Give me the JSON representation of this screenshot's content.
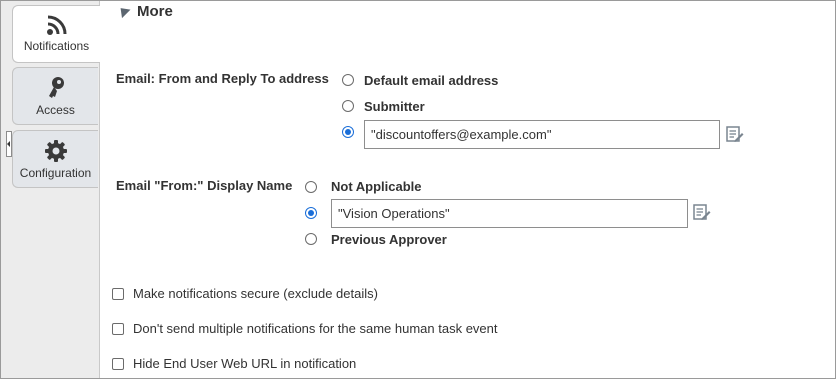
{
  "sidebar": {
    "tabs": [
      {
        "label": "Notifications",
        "icon": "rss-icon",
        "active": true
      },
      {
        "label": "Access",
        "icon": "key-icon",
        "active": false
      },
      {
        "label": "Configuration",
        "icon": "gear-icon",
        "active": false
      }
    ]
  },
  "section": {
    "title": "More"
  },
  "email_from": {
    "label": "Email: From and Reply To address",
    "options": [
      "Default email address",
      "Submitter"
    ],
    "selected_value": "\"discountoffers@example.com\""
  },
  "display_name": {
    "label": "Email \"From:\" Display Name",
    "options": [
      "Not Applicable",
      "Previous Approver"
    ],
    "selected_value": "\"Vision Operations\""
  },
  "checkboxes": [
    {
      "label": "Make notifications secure (exclude details)",
      "checked": false
    },
    {
      "label": "Don't send multiple notifications for the same human task event",
      "checked": false
    },
    {
      "label": "Hide End User Web URL in notification",
      "checked": false
    }
  ],
  "colors": {
    "accent": "#1a6ed8",
    "sidebar_bg": "#ececec",
    "text": "#333333"
  }
}
